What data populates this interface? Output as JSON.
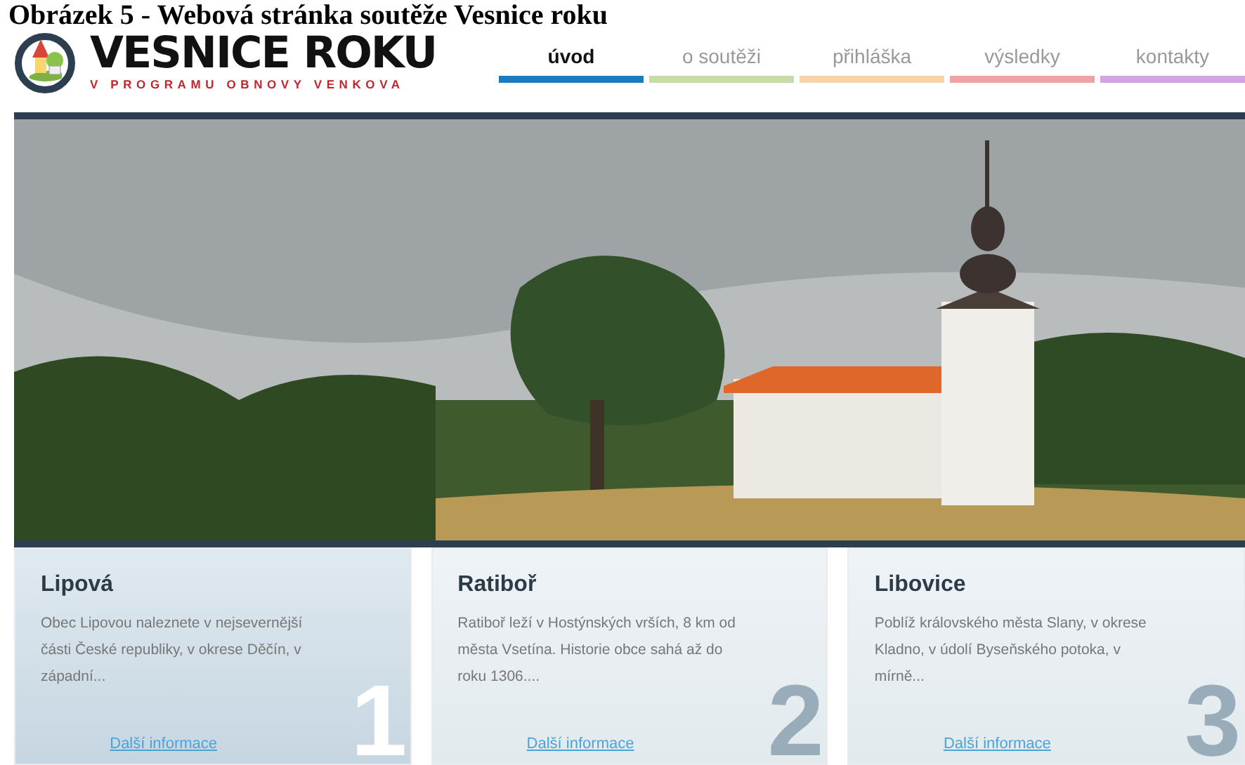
{
  "caption": "Obrázek 5 - Webová stránka soutěže Vesnice roku",
  "logo": {
    "title": "VESNICE ROKU",
    "subtitle": "V PROGRAMU OBNOVY VENKOVA"
  },
  "nav": [
    {
      "label": "úvod",
      "selected": true,
      "color": "#1a7bbf"
    },
    {
      "label": "o soutěži",
      "selected": false,
      "color": "#c5dca8"
    },
    {
      "label": "přihláška",
      "selected": false,
      "color": "#f8d2a8"
    },
    {
      "label": "výsledky",
      "selected": false,
      "color": "#f0a3a3"
    },
    {
      "label": "kontakty",
      "selected": false,
      "color": "#d5a3e2"
    }
  ],
  "villages": [
    {
      "name": "Lipová",
      "text": "Obec Lipovou naleznete v nejsevernější části České republiky, v okrese Děčín, v západní...",
      "link": "Další informace",
      "number": "1",
      "selected": true
    },
    {
      "name": "Ratiboř",
      "text": "Ratiboř leží v Hostýnských vrších, 8 km od města Vsetína. Historie obce sahá až do roku 1306....",
      "link": "Další informace",
      "number": "2",
      "selected": false
    },
    {
      "name": "Libovice",
      "text": "Poblíž královského města Slany, v okrese Kladno, v údolí Byseňského potoka, v mírně...",
      "link": "Další informace",
      "number": "3",
      "selected": false
    }
  ]
}
